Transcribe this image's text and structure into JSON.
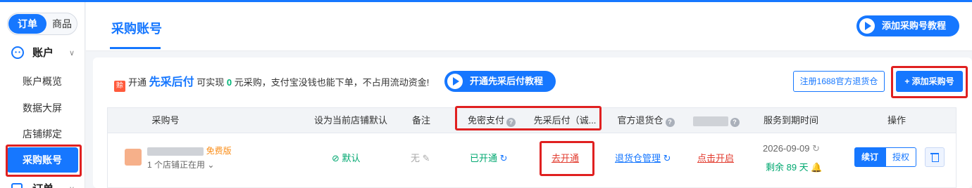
{
  "sidebar": {
    "toggle": {
      "active": "订单",
      "inactive": "商品"
    },
    "group_label": "账户",
    "items": [
      {
        "label": "账户概览"
      },
      {
        "label": "数据大屏"
      },
      {
        "label": "店铺绑定"
      },
      {
        "label": "采购账号",
        "active": true
      }
    ],
    "next_group_label": "订单"
  },
  "header": {
    "title": "采购账号",
    "tutorial_button": "添加采购号教程"
  },
  "promo": {
    "tag": "赊",
    "prefix": "开通",
    "brand": "先采后付",
    "middle": "可实现",
    "zero": "0",
    "suffix": "元采购，支付宝没钱也能下单，不占用流动资金!",
    "tutorial_button": "开通先采后付教程"
  },
  "actions": {
    "register_button": "注册1688官方退货仓",
    "add_button": "+ 添加采购号"
  },
  "table": {
    "columns": [
      "采购号",
      "设为当前店铺默认",
      "备注",
      "免密支付",
      "先采后付（诚...",
      "官方退货仓",
      "",
      "服务到期时间",
      "操作"
    ],
    "rows": [
      {
        "tag": "免费版",
        "shops": "1 个店铺正在用",
        "default": "默认",
        "note": "无",
        "nopass": "已开通",
        "paylater": "去开通",
        "return_wh": "退货仓管理",
        "extra": "点击开启",
        "expire_date": "2026-09-09",
        "remaining": "剩余 89 天",
        "ops": {
          "renew": "续订",
          "auth": "授权"
        }
      }
    ]
  },
  "colors": {
    "accent": "#1677ff",
    "highlight": "#e02020",
    "success": "#00a870"
  }
}
